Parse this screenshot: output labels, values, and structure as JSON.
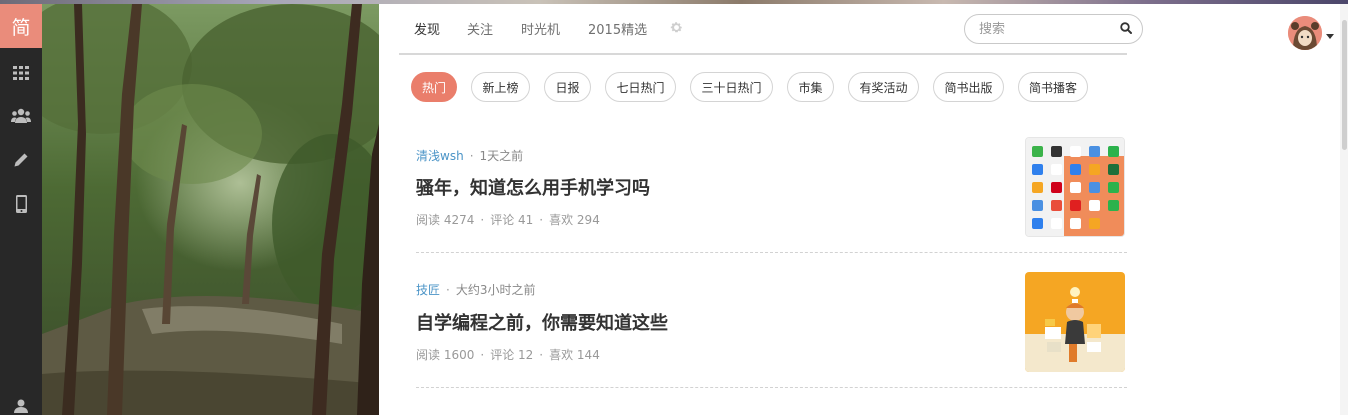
{
  "sidebar": {
    "logo_text": "简",
    "logo_color": "#ea8c7b",
    "items": [
      {
        "icon": "grid-icon"
      },
      {
        "icon": "users-icon"
      },
      {
        "icon": "pencil-icon"
      },
      {
        "icon": "mobile-icon"
      },
      {
        "icon": "user-icon"
      }
    ]
  },
  "nav": {
    "tabs": [
      {
        "label": "发现",
        "active": true
      },
      {
        "label": "关注",
        "active": false
      },
      {
        "label": "时光机",
        "active": false
      },
      {
        "label": "2015精选",
        "active": false
      }
    ],
    "settings_icon": "gear-icon"
  },
  "search": {
    "placeholder": "搜索",
    "icon": "search-icon"
  },
  "user": {
    "avatar": "avatar",
    "menu_icon": "caret-down-icon"
  },
  "categories": [
    {
      "label": "热门",
      "active": true
    },
    {
      "label": "新上榜",
      "active": false
    },
    {
      "label": "日报",
      "active": false
    },
    {
      "label": "七日热门",
      "active": false
    },
    {
      "label": "三十日热门",
      "active": false
    },
    {
      "label": "市集",
      "active": false
    },
    {
      "label": "有奖活动",
      "active": false
    },
    {
      "label": "简书出版",
      "active": false
    },
    {
      "label": "简书播客",
      "active": false
    }
  ],
  "articles": [
    {
      "author": "清浅wsh",
      "time": "1天之前",
      "title": "骚年，知道怎么用手机学习吗",
      "reads": "阅读 4274",
      "comments": "评论 41",
      "likes": "喜欢 294"
    },
    {
      "author": "技匠",
      "time": "大约3小时之前",
      "title": "自学编程之前，你需要知道这些",
      "reads": "阅读 1600",
      "comments": "评论 12",
      "likes": "喜欢 144"
    }
  ],
  "colors": {
    "accent": "#ea7e6b",
    "author_link": "#4b94c7",
    "sidebar_bg": "#282828"
  }
}
